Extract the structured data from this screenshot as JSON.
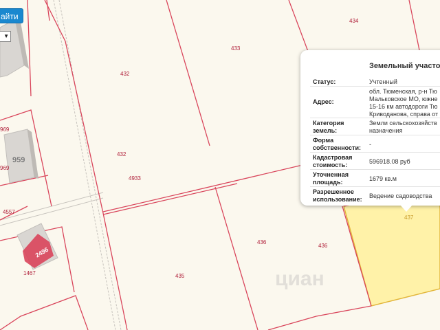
{
  "toolbar": {
    "find_button": "айти"
  },
  "map": {
    "parcel_labels": [
      "434",
      "433",
      "432",
      "432",
      "4933",
      "436",
      "436",
      "435",
      "437",
      "4557",
      "1467",
      "969",
      "969"
    ],
    "building_labels": [
      "959",
      "2496"
    ],
    "watermark": "циан"
  },
  "popup": {
    "title": "Земельный участо",
    "fields": [
      {
        "key": "Статус:",
        "value": "Учтенный"
      },
      {
        "key": "Адрес:",
        "value_lines": [
          "обл. Тюменская, р-н Тю",
          "Мальковское МО, южне",
          "15-16 км автодороги Тю",
          "Криводанова, справа от"
        ]
      },
      {
        "key_lines": [
          "Категория",
          "земель:"
        ],
        "value_lines": [
          "Земли сельскохозяйств",
          "назначения"
        ]
      },
      {
        "key_lines": [
          "Форма",
          "собственности:"
        ],
        "value": "-"
      },
      {
        "key_lines": [
          "Кадастровая",
          "стоимость:"
        ],
        "value": "596918.08 руб"
      },
      {
        "key_lines": [
          "Уточненная",
          "площадь:"
        ],
        "value": "1679 кв.м"
      },
      {
        "key_lines": [
          "Разрешенное",
          "использование:"
        ],
        "value": "Ведение садоводства"
      }
    ]
  },
  "colors": {
    "parcel_line": "#d9455b",
    "selected_fill": "#fff2a8",
    "selected_border": "#e2b63a",
    "button": "#1a88cf"
  }
}
